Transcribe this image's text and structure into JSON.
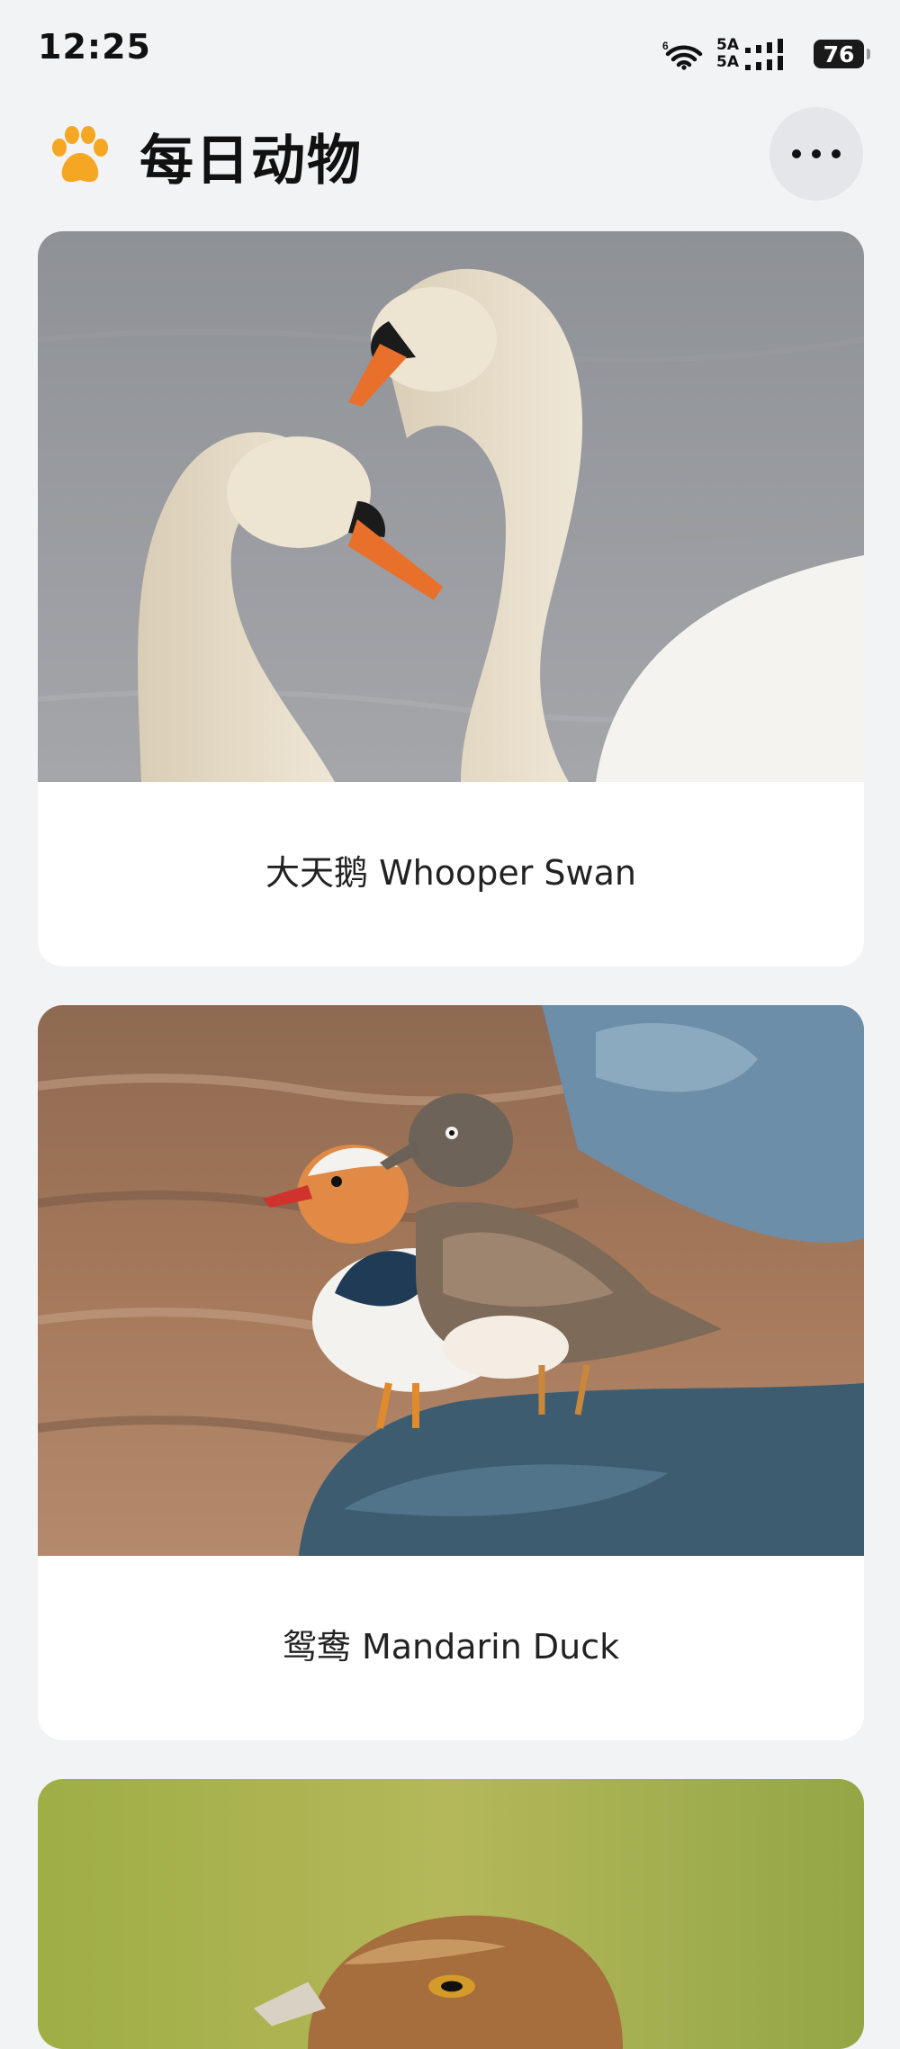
{
  "status_bar": {
    "time": "12:25",
    "network_top": "5A",
    "network_bottom": "5A",
    "battery": "76",
    "icons": [
      "wifi-icon",
      "signal-icon",
      "battery-icon"
    ]
  },
  "header": {
    "logo_icon": "paw-icon",
    "title": "每日动物",
    "more_icon": "more-horizontal-icon"
  },
  "animals": [
    {
      "name": "大天鹅 Whooper Swan",
      "photo": "swan-photo"
    },
    {
      "name": "鸳鸯 Mandarin Duck",
      "photo": "mandarin-duck-photo"
    },
    {
      "name": "",
      "photo": "eagle-photo"
    }
  ],
  "colors": {
    "background": "#F1F3F5",
    "card": "#FFFFFF",
    "accent_paw": "#F5A623",
    "more_button_bg": "#E4E6E9"
  }
}
